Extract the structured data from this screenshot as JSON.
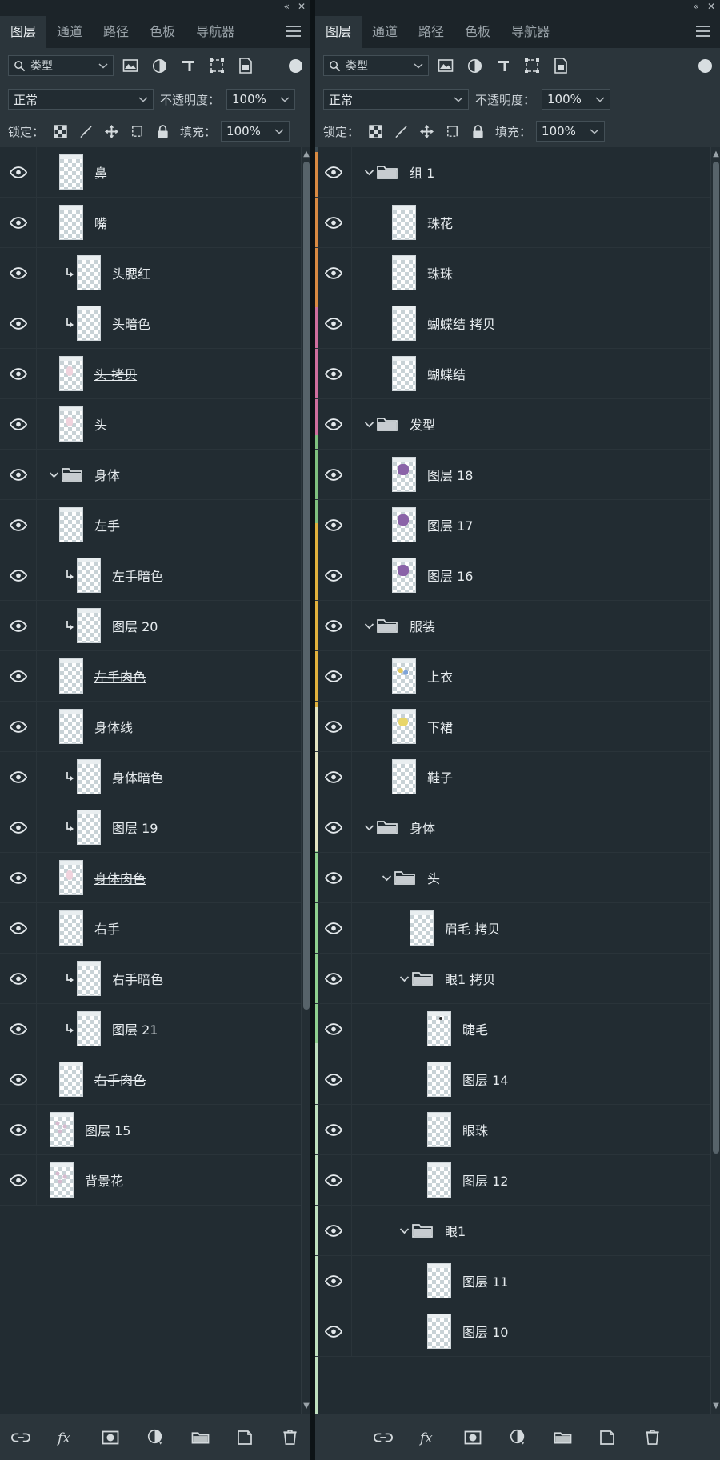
{
  "window": {
    "collapse_label": "«",
    "close_label": "✕"
  },
  "panels": [
    {
      "id": "left",
      "tabs": [
        {
          "label": "图层",
          "active": true
        },
        {
          "label": "通道",
          "active": false
        },
        {
          "label": "路径",
          "active": false
        },
        {
          "label": "色板",
          "active": false
        },
        {
          "label": "导航器",
          "active": false
        }
      ],
      "filter": {
        "kind_label": "类型",
        "icons": [
          "image-filter-icon",
          "adjustment-filter-icon",
          "text-filter-icon",
          "shape-filter-icon",
          "smartobject-filter-icon"
        ],
        "toggle": "filter-enable-toggle"
      },
      "blend": {
        "mode": "正常",
        "opacity_label": "不透明度：",
        "opacity_value": "100%"
      },
      "lock": {
        "label": "锁定：",
        "icons": [
          "lock-transparent-icon",
          "lock-image-icon",
          "lock-position-icon",
          "lock-artboard-icon",
          "lock-all-icon"
        ],
        "fill_label": "填充：",
        "fill_value": "100%"
      },
      "layers": [
        {
          "name": "鼻",
          "indent": 1,
          "type": "layer",
          "thumb": "empty"
        },
        {
          "name": "嘴",
          "indent": 1,
          "type": "layer",
          "thumb": "empty"
        },
        {
          "name": "头腮红",
          "indent": 2,
          "type": "layer",
          "clipped": true,
          "thumb": "empty"
        },
        {
          "name": "头暗色",
          "indent": 2,
          "type": "layer",
          "clipped": true,
          "thumb": "empty"
        },
        {
          "name": "头 拷贝",
          "indent": 1,
          "type": "layer",
          "struck": true,
          "thumb": "pink"
        },
        {
          "name": "头",
          "indent": 1,
          "type": "layer",
          "thumb": "pink"
        },
        {
          "name": "身体",
          "indent": 1,
          "type": "group",
          "expanded": true
        },
        {
          "name": "左手",
          "indent": 1,
          "type": "layer",
          "thumb": "empty"
        },
        {
          "name": "左手暗色",
          "indent": 2,
          "type": "layer",
          "clipped": true,
          "thumb": "empty"
        },
        {
          "name": "图层 20",
          "indent": 2,
          "type": "layer",
          "clipped": true,
          "thumb": "empty"
        },
        {
          "name": "左手肉色",
          "indent": 1,
          "type": "layer",
          "struck": true,
          "thumb": "empty"
        },
        {
          "name": "身体线",
          "indent": 1,
          "type": "layer",
          "thumb": "empty"
        },
        {
          "name": "身体暗色",
          "indent": 2,
          "type": "layer",
          "clipped": true,
          "thumb": "empty"
        },
        {
          "name": "图层 19",
          "indent": 2,
          "type": "layer",
          "clipped": true,
          "thumb": "empty"
        },
        {
          "name": "身体肉色",
          "indent": 1,
          "type": "layer",
          "struck": true,
          "thumb": "pink"
        },
        {
          "name": "右手",
          "indent": 1,
          "type": "layer",
          "thumb": "empty"
        },
        {
          "name": "右手暗色",
          "indent": 2,
          "type": "layer",
          "clipped": true,
          "thumb": "empty"
        },
        {
          "name": "图层 21",
          "indent": 2,
          "type": "layer",
          "clipped": true,
          "thumb": "empty"
        },
        {
          "name": "右手肉色",
          "indent": 1,
          "type": "layer",
          "struck": true,
          "thumb": "empty"
        },
        {
          "name": "图层 15",
          "indent": 0,
          "type": "layer",
          "thumb": "flowers"
        },
        {
          "name": "背景花",
          "indent": 0,
          "type": "layer",
          "thumb": "flowers"
        }
      ],
      "scrollbar": {
        "top_pct": 0,
        "height_pct": 78
      },
      "bottom_icons": [
        "link-layers-icon",
        "layer-style-fx-icon",
        "layer-mask-icon",
        "adjustment-layer-icon",
        "new-group-icon",
        "new-layer-icon",
        "delete-layer-icon"
      ]
    },
    {
      "id": "right",
      "tabs": [
        {
          "label": "图层",
          "active": true
        },
        {
          "label": "通道",
          "active": false
        },
        {
          "label": "路径",
          "active": false
        },
        {
          "label": "色板",
          "active": false
        },
        {
          "label": "导航器",
          "active": false
        }
      ],
      "filter": {
        "kind_label": "类型",
        "icons": [
          "image-filter-icon",
          "adjustment-filter-icon",
          "text-filter-icon",
          "shape-filter-icon",
          "smartobject-filter-icon"
        ],
        "toggle": "filter-enable-toggle"
      },
      "blend": {
        "mode": "正常",
        "opacity_label": "不透明度：",
        "opacity_value": "100%"
      },
      "lock": {
        "label": "锁定：",
        "icons": [
          "lock-transparent-icon",
          "lock-image-icon",
          "lock-position-icon",
          "lock-artboard-icon",
          "lock-all-icon"
        ],
        "fill_label": "填充：",
        "fill_value": "100%"
      },
      "layers": [
        {
          "name": "组 1",
          "indent": 1,
          "type": "group",
          "expanded": true
        },
        {
          "name": "珠花",
          "indent": 2,
          "type": "layer",
          "thumb": "empty"
        },
        {
          "name": "珠珠",
          "indent": 2,
          "type": "layer",
          "thumb": "empty"
        },
        {
          "name": "蝴蝶结 拷贝",
          "indent": 2,
          "type": "layer",
          "thumb": "empty"
        },
        {
          "name": "蝴蝶结",
          "indent": 2,
          "type": "layer",
          "thumb": "empty"
        },
        {
          "name": "发型",
          "indent": 1,
          "type": "group",
          "expanded": true
        },
        {
          "name": "图层 18",
          "indent": 2,
          "type": "layer",
          "thumb": "purple"
        },
        {
          "name": "图层 17",
          "indent": 2,
          "type": "layer",
          "thumb": "purple"
        },
        {
          "name": "图层 16",
          "indent": 2,
          "type": "layer",
          "thumb": "purple"
        },
        {
          "name": "服装",
          "indent": 1,
          "type": "group",
          "expanded": true
        },
        {
          "name": "上衣",
          "indent": 2,
          "type": "layer",
          "thumb": "multi"
        },
        {
          "name": "下裙",
          "indent": 2,
          "type": "layer",
          "thumb": "yellow"
        },
        {
          "name": "鞋子",
          "indent": 2,
          "type": "layer",
          "thumb": "empty"
        },
        {
          "name": "身体",
          "indent": 1,
          "type": "group",
          "expanded": true
        },
        {
          "name": "头",
          "indent": 2,
          "type": "group",
          "expanded": true
        },
        {
          "name": "眉毛 拷贝",
          "indent": 3,
          "type": "layer",
          "thumb": "empty"
        },
        {
          "name": "眼1 拷贝",
          "indent": 3,
          "type": "group",
          "expanded": true
        },
        {
          "name": "睫毛",
          "indent": 4,
          "type": "layer",
          "thumb": "dot"
        },
        {
          "name": "图层 14",
          "indent": 4,
          "type": "layer",
          "thumb": "empty"
        },
        {
          "name": "眼珠",
          "indent": 4,
          "type": "layer",
          "thumb": "empty"
        },
        {
          "name": "图层 12",
          "indent": 4,
          "type": "layer",
          "thumb": "empty"
        },
        {
          "name": "眼1",
          "indent": 3,
          "type": "group",
          "expanded": true
        },
        {
          "name": "图层 11",
          "indent": 4,
          "type": "layer",
          "thumb": "empty"
        },
        {
          "name": "图层 10",
          "indent": 4,
          "type": "layer",
          "thumb": "empty"
        }
      ],
      "scrollbar": {
        "top_pct": 0,
        "height_pct": 92
      },
      "bottom_icons": [
        "link-layers-icon",
        "layer-style-fx-icon",
        "layer-mask-icon",
        "adjustment-layer-icon",
        "new-group-icon",
        "new-layer-icon",
        "delete-layer-icon"
      ]
    }
  ]
}
